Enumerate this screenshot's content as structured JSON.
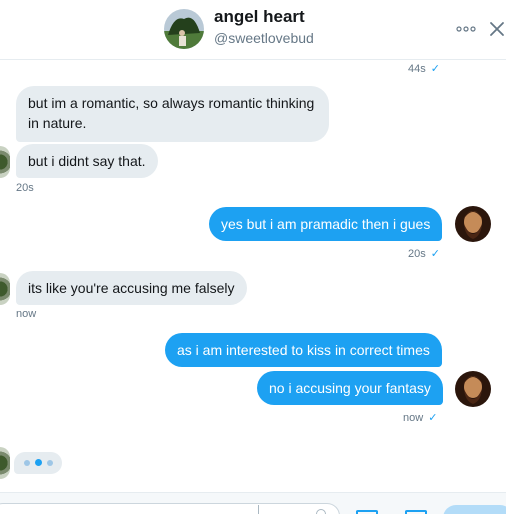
{
  "header": {
    "name": "angel heart",
    "handle": "@sweetlovebud",
    "avatar_icon": "profile-photo",
    "more_icon": "more-dots-icon",
    "close_icon": "close-icon"
  },
  "conversation": {
    "top_receipt": {
      "time": "44s",
      "check": "✓"
    },
    "messages": [
      {
        "direction": "incoming",
        "lines": [
          "but im a romantic, so always romantic thinking",
          "in nature."
        ]
      },
      {
        "direction": "incoming",
        "lines": [
          "but i didnt say that."
        ],
        "time": "20s"
      },
      {
        "direction": "outgoing",
        "lines": [
          "yes but i am pramadic then i gues"
        ],
        "time": "20s",
        "check": "✓"
      },
      {
        "direction": "incoming",
        "lines": [
          "its like you're accusing me falsely"
        ],
        "time": "now"
      },
      {
        "direction": "outgoing",
        "lines": [
          "as i am interested to kiss in correct times"
        ]
      },
      {
        "direction": "outgoing",
        "lines": [
          "no i accusing your fantasy"
        ],
        "time": "now",
        "check": "✓"
      }
    ],
    "typing_indicator": true
  },
  "composer": {
    "placeholder": "",
    "icons": [
      "emoji-icon",
      "gif-icon",
      "media-icon"
    ]
  },
  "colors": {
    "accent": "#1da1f2",
    "incoming_bubble": "#e6ecf0",
    "meta_text": "#657786"
  }
}
